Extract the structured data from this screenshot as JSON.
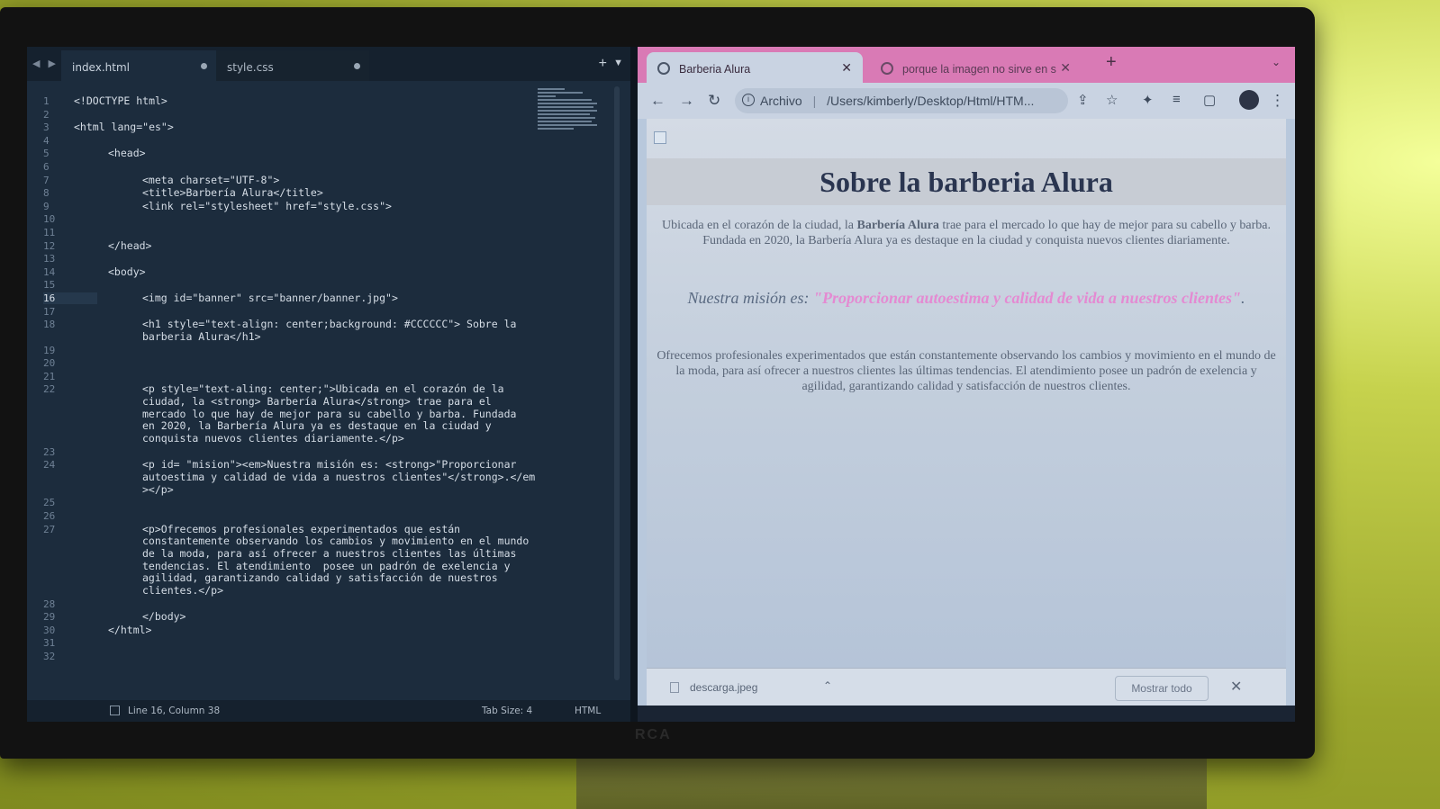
{
  "editor": {
    "tabs": [
      {
        "label": "index.html"
      },
      {
        "label": "style.css"
      }
    ],
    "line_numbers": [
      "1",
      "2",
      "3",
      "4",
      "5",
      "6",
      "7",
      "8",
      "9",
      "10",
      "11",
      "12",
      "13",
      "14",
      "15",
      "16",
      "17",
      "18",
      "19",
      "20",
      "21",
      "22",
      "23",
      "24",
      "25",
      "26",
      "27",
      "28",
      "29",
      "30",
      "31",
      "32"
    ],
    "current_line": "16",
    "code": [
      {
        "ln": "1",
        "text": "<!DOCTYPE html>"
      },
      {
        "ln": "3",
        "text": "<html lang=\"es\">"
      },
      {
        "ln": "5",
        "text": "<head>"
      },
      {
        "ln": "7",
        "text": "<meta charset=\"UTF-8\">"
      },
      {
        "ln": "8",
        "text": "<title>Barbería Alura</title>"
      },
      {
        "ln": "9",
        "text": "<link rel=\"stylesheet\" href=\"style.css\">"
      },
      {
        "ln": "12",
        "text": "</head>"
      },
      {
        "ln": "14",
        "text": "<body>"
      },
      {
        "ln": "16",
        "text": "<img id=\"banner\" src=\"banner/banner.jpg\">"
      },
      {
        "ln": "18",
        "text": "<h1 style=\"text-align: center;background: #CCCCCC\"> Sobre la\nbarberia Alura</h1>"
      },
      {
        "ln": "22",
        "text": "<p style=\"text-aling: center;\">Ubicada en el corazón de la\nciudad, la <strong> Barbería Alura</strong> trae para el\nmercado lo que hay de mejor para su cabello y barba. Fundada\nen 2020, la Barbería Alura ya es destaque en la ciudad y\nconquista nuevos clientes diariamente.</p>"
      },
      {
        "ln": "24",
        "text": "<p id= \"mision\"><em>Nuestra misión es: <strong>\"Proporcionar\nautoestima y calidad de vida a nuestros clientes\"</strong>.</em\n></p>"
      },
      {
        "ln": "27",
        "text": "<p>Ofrecemos profesionales experimentados que están\nconstantemente observando los cambios y movimiento en el mundo\nde la moda, para así ofrecer a nuestros clientes las últimas\ntendencias. El atendimiento  posee un padrón de exelencia y\nagilidad, garantizando calidad y satisfacción de nuestros\nclientes.</p>"
      },
      {
        "ln": "29",
        "text": "</body>"
      },
      {
        "ln": "30",
        "text": "</html>"
      }
    ],
    "status": {
      "position": "Line 16, Column 38",
      "tab_size": "Tab Size: 4",
      "syntax": "HTML"
    }
  },
  "browser": {
    "tabs": [
      {
        "label": "Barberia Alura"
      },
      {
        "label": "porque la imagen no sirve en s"
      }
    ],
    "address": {
      "scheme_label": "Archivo",
      "url": "/Users/kimberly/Desktop/Html/HTM..."
    },
    "page": {
      "h1": "Sobre la barberia Alura",
      "p1_before": "Ubicada en el corazón de la ciudad, la ",
      "p1_strong": "Barbería Alura",
      "p1_after": " trae para el mercado lo que hay de mejor para su cabello y barba. Fundada en 2020, la Barbería Alura ya es destaque en la ciudad y conquista nuevos clientes diariamente.",
      "mision_em": "Nuestra misión es: ",
      "mision_strong": "\"Proporcionar autoestima y calidad de vida a nuestros clientes\"",
      "mision_end": ".",
      "p3": "Ofrecemos profesionales experimentados que están constantemente observando los cambios y movimiento en el mundo de la moda, para así ofrecer a nuestros clientes las últimas tendencias. El atendimiento posee un padrón de exelencia y agilidad, garantizando calidad y satisfacción de nuestros clientes."
    },
    "downloads": {
      "file": "descarga.jpeg",
      "show_all": "Mostrar todo"
    }
  },
  "monitor_brand": "RCA"
}
